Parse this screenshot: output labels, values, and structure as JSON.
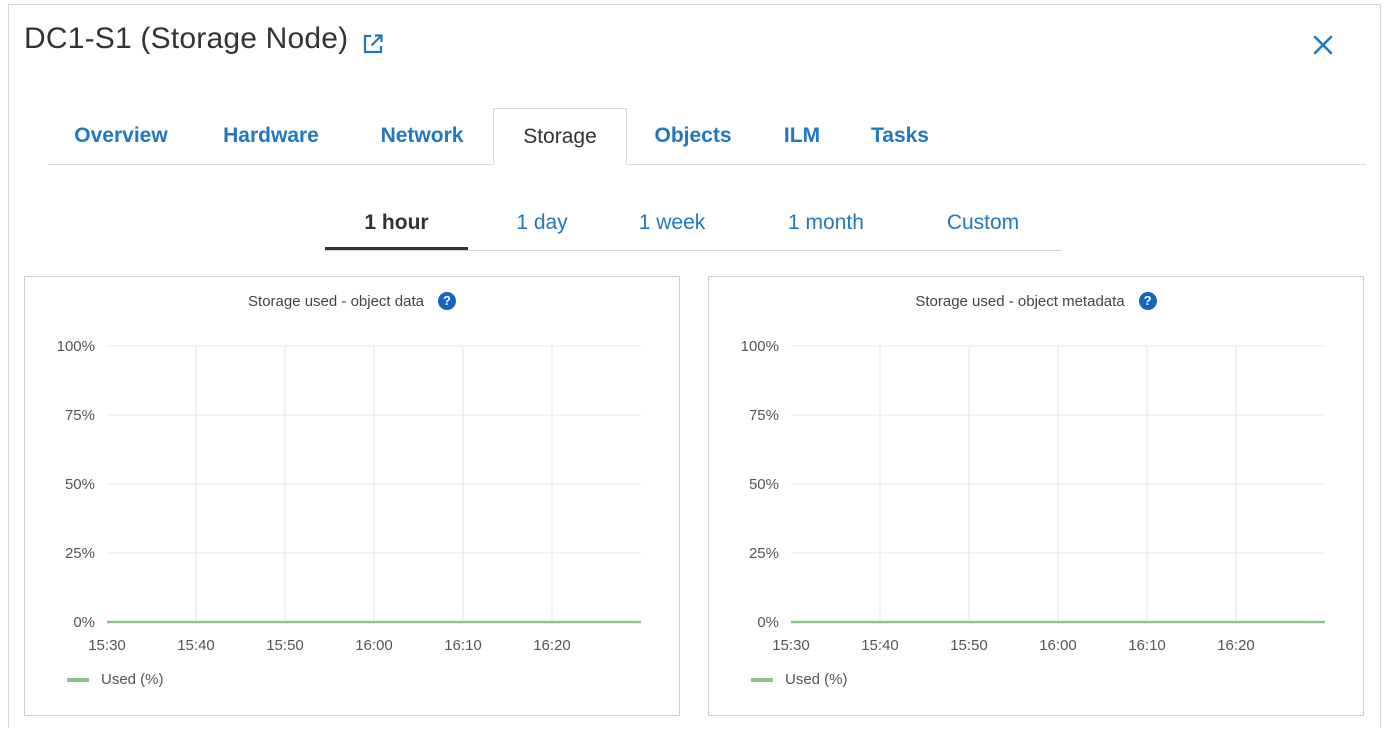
{
  "header": {
    "title": "DC1-S1 (Storage Node)",
    "external_link_icon": "external-link-icon",
    "close_icon": "close-icon"
  },
  "tabs": [
    {
      "label": "Overview",
      "active": false
    },
    {
      "label": "Hardware",
      "active": false
    },
    {
      "label": "Network",
      "active": false
    },
    {
      "label": "Storage",
      "active": true
    },
    {
      "label": "Objects",
      "active": false
    },
    {
      "label": "ILM",
      "active": false
    },
    {
      "label": "Tasks",
      "active": false
    }
  ],
  "periods": [
    {
      "label": "1 hour",
      "active": true
    },
    {
      "label": "1 day",
      "active": false
    },
    {
      "label": "1 week",
      "active": false
    },
    {
      "label": "1 month",
      "active": false
    },
    {
      "label": "Custom",
      "active": false
    }
  ],
  "colors": {
    "link": "#1f78c1",
    "help_icon": "#1565c0",
    "series_used": "#8bc48a"
  },
  "chart_data": [
    {
      "type": "line",
      "title": "Storage used - object data",
      "help_icon": "help-icon",
      "x": [
        "15:30",
        "15:40",
        "15:50",
        "16:00",
        "16:10",
        "16:20"
      ],
      "yticks": [
        "100%",
        "75%",
        "50%",
        "25%",
        "0%"
      ],
      "ylim": [
        0,
        100
      ],
      "grid": true,
      "legend": "bottom-left",
      "series": [
        {
          "name": "Used (%)",
          "values": [
            0,
            0,
            0,
            0,
            0,
            0
          ]
        }
      ]
    },
    {
      "type": "line",
      "title": "Storage used - object metadata",
      "help_icon": "help-icon",
      "x": [
        "15:30",
        "15:40",
        "15:50",
        "16:00",
        "16:10",
        "16:20"
      ],
      "yticks": [
        "100%",
        "75%",
        "50%",
        "25%",
        "0%"
      ],
      "ylim": [
        0,
        100
      ],
      "grid": true,
      "legend": "bottom-left",
      "series": [
        {
          "name": "Used (%)",
          "values": [
            0,
            0,
            0,
            0,
            0,
            0
          ]
        }
      ]
    }
  ]
}
